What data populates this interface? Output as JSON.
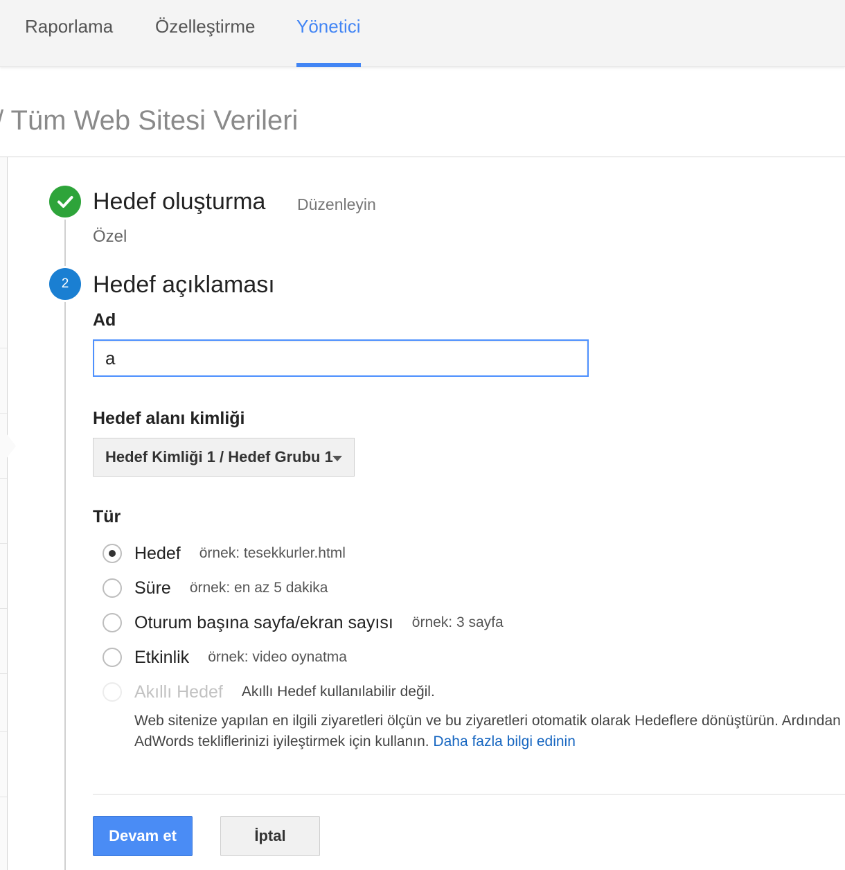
{
  "nav": {
    "tabs": [
      {
        "label": "Raporlama"
      },
      {
        "label": "Özelleştirme"
      },
      {
        "label": "Yönetici"
      }
    ],
    "active_color": "#4285f4"
  },
  "breadcrumb": "/ Tüm Web Sitesi Verileri",
  "step1": {
    "title": "Hedef oluşturma",
    "edit_label": "Düzenleyin",
    "summary": "Özel"
  },
  "step2": {
    "number": "2",
    "title": "Hedef açıklaması",
    "name_label": "Ad",
    "name_value": "a",
    "goal_id_label": "Hedef alanı kimliği",
    "goal_id_selected": "Hedef Kimliği 1 / Hedef Grubu 1",
    "type_label": "Tür",
    "types": [
      {
        "label": "Hedef",
        "hint": "örnek: tesekkurler.html"
      },
      {
        "label": "Süre",
        "hint": "örnek: en az 5 dakika"
      },
      {
        "label": "Oturum başına sayfa/ekran sayısı",
        "hint": "örnek: 3 sayfa"
      },
      {
        "label": "Etkinlik",
        "hint": "örnek: video oynatma"
      },
      {
        "label": "Akıllı Hedef",
        "hint": "Akıllı Hedef kullanılabilir değil."
      }
    ],
    "smart_description": "Web sitenize yapılan en ilgili ziyaretleri ölçün ve bu ziyaretleri otomatik olarak Hedeflere dönüştürün. Ardından AdWords tekliflerinizi iyileştirmek için kullanın.",
    "learn_more": "Daha fazla bilgi edinin"
  },
  "actions": {
    "continue_label": "Devam et",
    "cancel_label": "İptal"
  }
}
